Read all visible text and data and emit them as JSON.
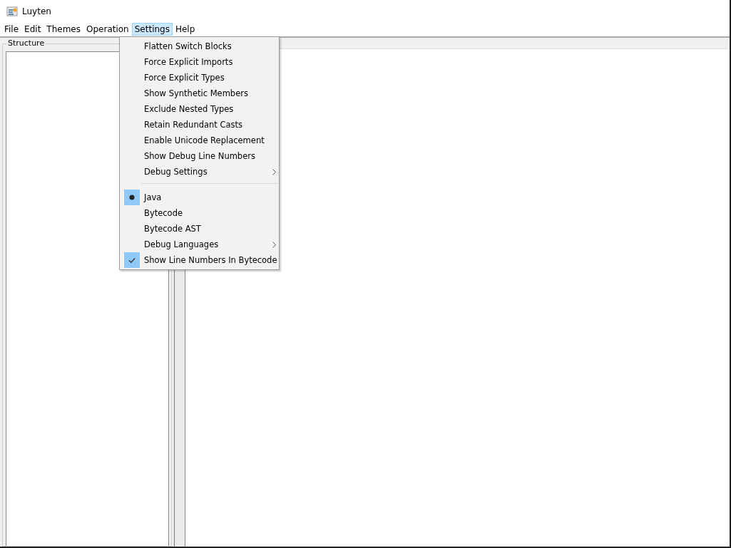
{
  "window": {
    "title": "Luyten"
  },
  "menu_bar": [
    {
      "label": "File",
      "selected": false
    },
    {
      "label": "Edit",
      "selected": false
    },
    {
      "label": "Themes",
      "selected": false
    },
    {
      "label": "Operation",
      "selected": false
    },
    {
      "label": "Settings",
      "selected": true
    },
    {
      "label": "Help",
      "selected": false
    }
  ],
  "structure_panel": {
    "title": "Structure"
  },
  "settings_menu": [
    {
      "kind": "check",
      "label": "Flatten Switch Blocks",
      "checked": false
    },
    {
      "kind": "check",
      "label": "Force Explicit Imports",
      "checked": false
    },
    {
      "kind": "check",
      "label": "Force Explicit Types",
      "checked": false
    },
    {
      "kind": "check",
      "label": "Show Synthetic Members",
      "checked": false
    },
    {
      "kind": "check",
      "label": "Exclude Nested Types",
      "checked": false
    },
    {
      "kind": "check",
      "label": "Retain Redundant Casts",
      "checked": false
    },
    {
      "kind": "check",
      "label": "Enable Unicode Replacement",
      "checked": false
    },
    {
      "kind": "check",
      "label": "Show Debug Line Numbers",
      "checked": false
    },
    {
      "kind": "submenu",
      "label": "Debug Settings"
    },
    {
      "kind": "separator"
    },
    {
      "kind": "radio",
      "label": "Java",
      "selected": true
    },
    {
      "kind": "radio",
      "label": "Bytecode",
      "selected": false
    },
    {
      "kind": "radio",
      "label": "Bytecode AST",
      "selected": false
    },
    {
      "kind": "submenu",
      "label": "Debug Languages"
    },
    {
      "kind": "check",
      "label": "Show Line Numbers In Bytecode",
      "checked": true
    }
  ]
}
